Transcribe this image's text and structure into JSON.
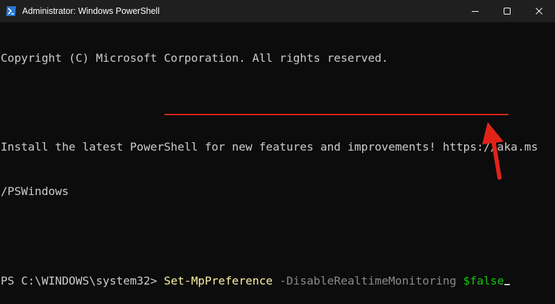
{
  "window": {
    "title": "Administrator: Windows PowerShell"
  },
  "titlebar_controls": {
    "minimize": "minimize-icon",
    "maximize": "maximize-icon",
    "close": "close-icon"
  },
  "terminal": {
    "lines": [
      "Copyright (C) Microsoft Corporation. All rights reserved.",
      "",
      "Install the latest PowerShell for new features and improvements! https://aka.ms",
      "/PSWindows",
      ""
    ],
    "prompt": {
      "path": "PS C:\\WINDOWS\\system32> ",
      "command": "Set-MpPreference",
      "parameter": "-DisableRealtimeMonitoring",
      "value": "$false"
    }
  },
  "colors": {
    "terminal_bg": "#0c0c0c",
    "titlebar_bg": "#1f1f1f",
    "text": "#cccccc",
    "cmdlet": "#f9f1a5",
    "parameter": "#8a8a8a",
    "variable": "#16c60c",
    "annotation": "#e2231a"
  }
}
